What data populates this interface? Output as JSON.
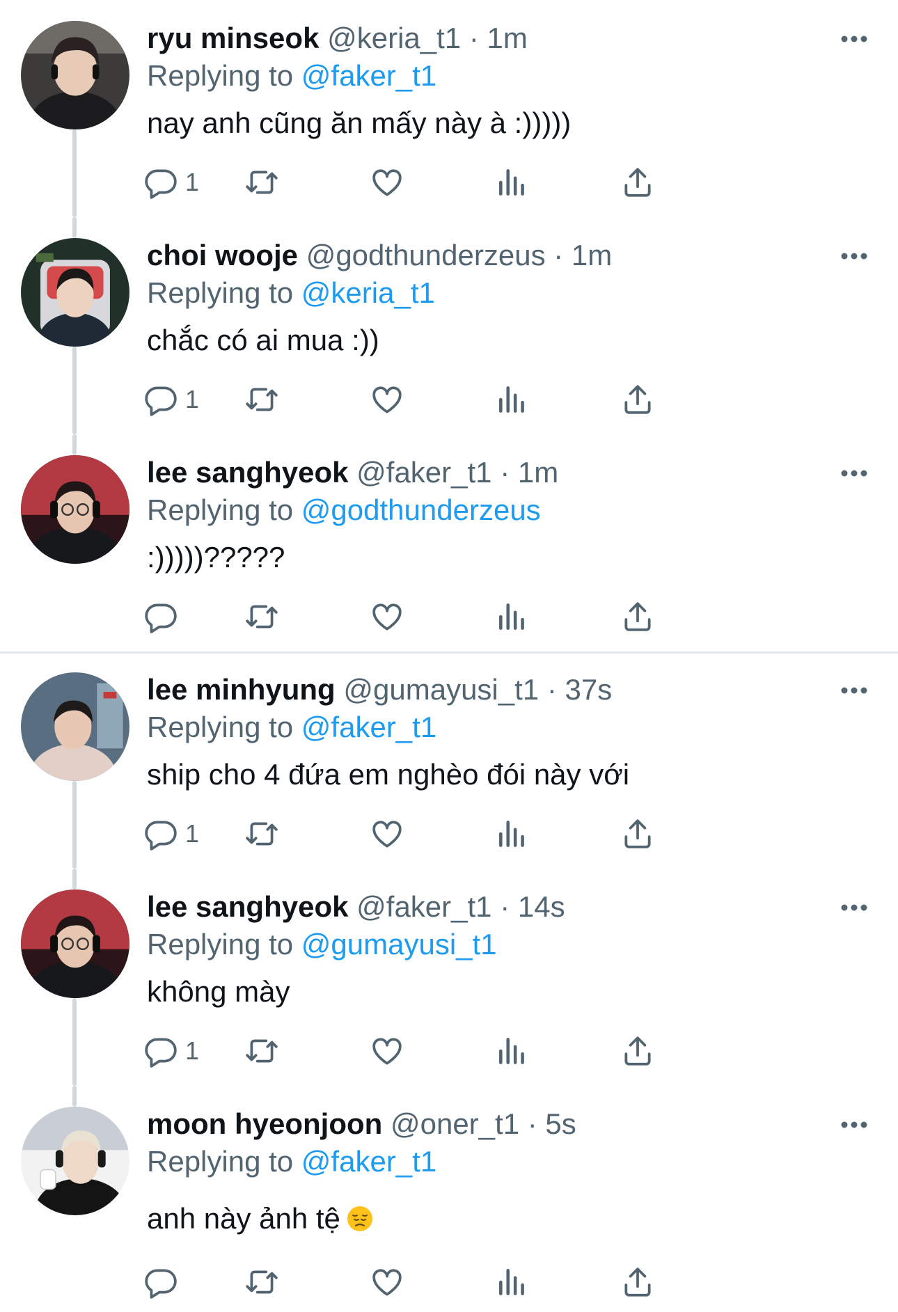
{
  "colors": {
    "accent": "#1d9bf0",
    "secondary_text": "#536471",
    "primary_text": "#0f1419",
    "thread_line": "#cfd9de",
    "separator": "#e6e9eb"
  },
  "icons": [
    "reply-icon",
    "retweet-icon",
    "like-icon",
    "analytics-icon",
    "share-icon",
    "more-icon",
    "pensive-face-emoji"
  ],
  "tweets": [
    {
      "name": "ryu minseok",
      "handle": "@keria_t1",
      "time": "1m",
      "replying_label": "Replying to",
      "replying_to": "@faker_t1",
      "text": "nay anh cũng ăn mấy này à :)))))",
      "reply_count": "1"
    },
    {
      "name": "choi wooje",
      "handle": "@godthunderzeus",
      "time": "1m",
      "replying_label": "Replying to",
      "replying_to": "@keria_t1",
      "text": "chắc có ai mua :))",
      "reply_count": "1"
    },
    {
      "name": "lee sanghyeok",
      "handle": "@faker_t1",
      "time": "1m",
      "replying_label": "Replying to",
      "replying_to": "@godthunderzeus",
      "text": ":)))))?????",
      "reply_count": ""
    },
    {
      "name": "lee minhyung",
      "handle": "@gumayusi_t1",
      "time": "37s",
      "replying_label": "Replying to",
      "replying_to": "@faker_t1",
      "text": "ship cho 4 đứa em nghèo đói này với",
      "reply_count": "1"
    },
    {
      "name": "lee sanghyeok",
      "handle": "@faker_t1",
      "time": "14s",
      "replying_label": "Replying to",
      "replying_to": "@gumayusi_t1",
      "text": "không mày",
      "reply_count": "1"
    },
    {
      "name": "moon hyeonjoon",
      "handle": "@oner_t1",
      "time": "5s",
      "replying_label": "Replying to",
      "replying_to": "@faker_t1",
      "text": "anh này ảnh tệ",
      "reply_count": ""
    }
  ]
}
